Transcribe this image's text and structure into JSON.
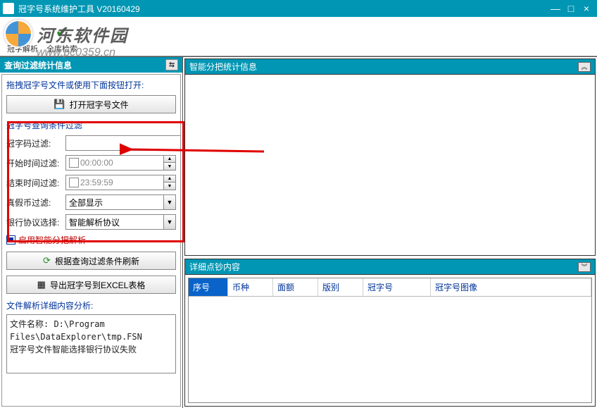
{
  "title": "冠字号系统维护工具 V20160429",
  "watermark": {
    "name": "河东软件园",
    "url": "www.pc0359.cn"
  },
  "toolbar": {
    "items": [
      {
        "label": "冠字解析",
        "icon": "📄"
      },
      {
        "label": "全库检索",
        "icon": "✔"
      }
    ]
  },
  "left": {
    "header": "查询过滤统计信息",
    "hint": "拖拽冠字号文件或使用下面按钮打开:",
    "open_btn": "打开冠字号文件",
    "filter_title": "冠字号查询条件过滤",
    "rows": {
      "code_label": "冠字码过滤:",
      "code_value": "",
      "start_label": "开始时间过滤:",
      "start_value": "00:00:00",
      "end_label": "结束时间过滤:",
      "end_value": "23:59:59",
      "tf_label": "真假币过滤:",
      "tf_value": "全部显示",
      "bank_label": "银行协议选择:",
      "bank_value": "智能解析协议"
    },
    "enable_smart": "启用智能分把解析",
    "refresh_btn": "根据查询过滤条件刷新",
    "export_btn": "导出冠字号到EXCEL表格",
    "file_section": "文件解析详细内容分析:",
    "file_detail": "文件名称: D:\\Program Files\\DataExplorer\\tmp.FSN\n冠字号文件智能选择银行协议失败"
  },
  "right_top": {
    "header": "智能分把统计信息"
  },
  "right_bottom": {
    "header": "详细点钞内容",
    "columns": [
      "序号",
      "币种",
      "面额",
      "版别",
      "冠字号",
      "冠字号图像"
    ]
  }
}
